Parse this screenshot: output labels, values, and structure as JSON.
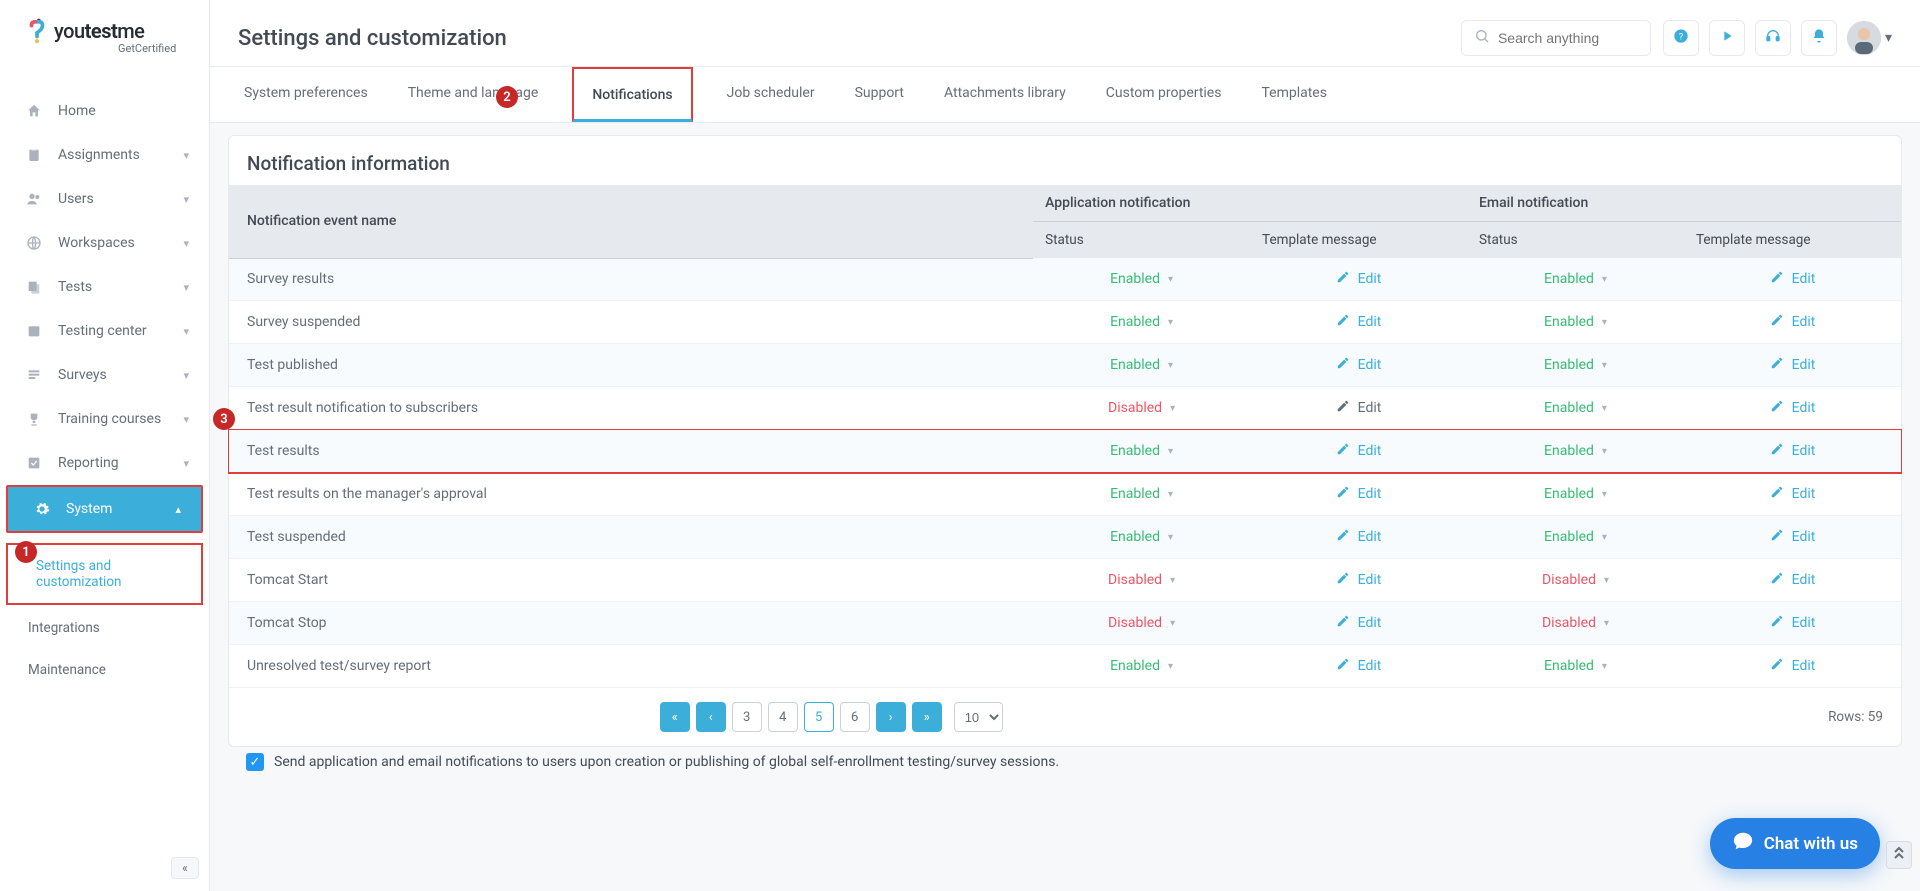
{
  "logo": {
    "brand_thin": "you",
    "brand_bold": "test",
    "brand_thin2": "me",
    "sub": "GetCertified"
  },
  "sidebar": {
    "items": [
      {
        "label": "Home"
      },
      {
        "label": "Assignments"
      },
      {
        "label": "Users"
      },
      {
        "label": "Workspaces"
      },
      {
        "label": "Tests"
      },
      {
        "label": "Testing center"
      },
      {
        "label": "Surveys"
      },
      {
        "label": "Training courses"
      },
      {
        "label": "Reporting"
      },
      {
        "label": "System"
      }
    ],
    "sub_items": [
      {
        "label": "Settings and customization"
      },
      {
        "label": "Integrations"
      },
      {
        "label": "Maintenance"
      }
    ]
  },
  "header": {
    "title": "Settings and customization",
    "search_placeholder": "Search anything"
  },
  "tabs": [
    "System preferences",
    "Theme and language",
    "Notifications",
    "Job scheduler",
    "Support",
    "Attachments library",
    "Custom properties",
    "Templates"
  ],
  "panel": {
    "title": "Notification information",
    "columns": {
      "event": "Notification event name",
      "app_group": "Application notification",
      "email_group": "Email notification",
      "status": "Status",
      "template": "Template message"
    },
    "edit_label": "Edit",
    "rows": [
      {
        "name": "Survey results",
        "app_status": "Enabled",
        "app_edit_style": "blue",
        "email_status": "Enabled",
        "email_edit_style": "blue"
      },
      {
        "name": "Survey suspended",
        "app_status": "Enabled",
        "app_edit_style": "blue",
        "email_status": "Enabled",
        "email_edit_style": "blue"
      },
      {
        "name": "Test published",
        "app_status": "Enabled",
        "app_edit_style": "blue",
        "email_status": "Enabled",
        "email_edit_style": "blue"
      },
      {
        "name": "Test result notification to subscribers",
        "app_status": "Disabled",
        "app_edit_style": "gray",
        "email_status": "Enabled",
        "email_edit_style": "blue"
      },
      {
        "name": "Test results",
        "app_status": "Enabled",
        "app_edit_style": "blue",
        "email_status": "Enabled",
        "email_edit_style": "blue"
      },
      {
        "name": "Test results on the manager's approval",
        "app_status": "Enabled",
        "app_edit_style": "blue",
        "email_status": "Enabled",
        "email_edit_style": "blue"
      },
      {
        "name": "Test suspended",
        "app_status": "Enabled",
        "app_edit_style": "blue",
        "email_status": "Enabled",
        "email_edit_style": "blue"
      },
      {
        "name": "Tomcat Start",
        "app_status": "Disabled",
        "app_edit_style": "blue",
        "email_status": "Disabled",
        "email_edit_style": "blue"
      },
      {
        "name": "Tomcat Stop",
        "app_status": "Disabled",
        "app_edit_style": "blue",
        "email_status": "Disabled",
        "email_edit_style": "blue"
      },
      {
        "name": "Unresolved test/survey report",
        "app_status": "Enabled",
        "app_edit_style": "blue",
        "email_status": "Enabled",
        "email_edit_style": "blue"
      }
    ],
    "pages": [
      "3",
      "4",
      "5",
      "6"
    ],
    "current_page": "5",
    "rows_per_page": "10",
    "rows_count": "Rows: 59",
    "checkbox_text": "Send application and email notifications to users upon creation or publishing of global self-enrollment testing/survey sessions."
  },
  "chat": {
    "label": "Chat with us"
  }
}
